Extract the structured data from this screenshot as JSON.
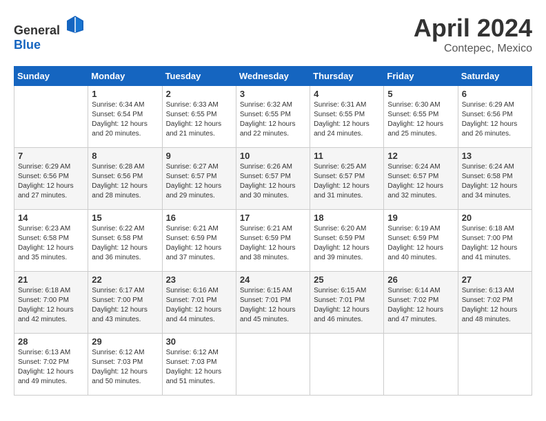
{
  "header": {
    "logo_general": "General",
    "logo_blue": "Blue",
    "month": "April 2024",
    "location": "Contepec, Mexico"
  },
  "weekdays": [
    "Sunday",
    "Monday",
    "Tuesday",
    "Wednesday",
    "Thursday",
    "Friday",
    "Saturday"
  ],
  "weeks": [
    [
      {
        "day": "",
        "info": ""
      },
      {
        "day": "1",
        "info": "Sunrise: 6:34 AM\nSunset: 6:54 PM\nDaylight: 12 hours\nand 20 minutes."
      },
      {
        "day": "2",
        "info": "Sunrise: 6:33 AM\nSunset: 6:55 PM\nDaylight: 12 hours\nand 21 minutes."
      },
      {
        "day": "3",
        "info": "Sunrise: 6:32 AM\nSunset: 6:55 PM\nDaylight: 12 hours\nand 22 minutes."
      },
      {
        "day": "4",
        "info": "Sunrise: 6:31 AM\nSunset: 6:55 PM\nDaylight: 12 hours\nand 24 minutes."
      },
      {
        "day": "5",
        "info": "Sunrise: 6:30 AM\nSunset: 6:55 PM\nDaylight: 12 hours\nand 25 minutes."
      },
      {
        "day": "6",
        "info": "Sunrise: 6:29 AM\nSunset: 6:56 PM\nDaylight: 12 hours\nand 26 minutes."
      }
    ],
    [
      {
        "day": "7",
        "info": "Sunrise: 6:29 AM\nSunset: 6:56 PM\nDaylight: 12 hours\nand 27 minutes."
      },
      {
        "day": "8",
        "info": "Sunrise: 6:28 AM\nSunset: 6:56 PM\nDaylight: 12 hours\nand 28 minutes."
      },
      {
        "day": "9",
        "info": "Sunrise: 6:27 AM\nSunset: 6:57 PM\nDaylight: 12 hours\nand 29 minutes."
      },
      {
        "day": "10",
        "info": "Sunrise: 6:26 AM\nSunset: 6:57 PM\nDaylight: 12 hours\nand 30 minutes."
      },
      {
        "day": "11",
        "info": "Sunrise: 6:25 AM\nSunset: 6:57 PM\nDaylight: 12 hours\nand 31 minutes."
      },
      {
        "day": "12",
        "info": "Sunrise: 6:24 AM\nSunset: 6:57 PM\nDaylight: 12 hours\nand 32 minutes."
      },
      {
        "day": "13",
        "info": "Sunrise: 6:24 AM\nSunset: 6:58 PM\nDaylight: 12 hours\nand 34 minutes."
      }
    ],
    [
      {
        "day": "14",
        "info": "Sunrise: 6:23 AM\nSunset: 6:58 PM\nDaylight: 12 hours\nand 35 minutes."
      },
      {
        "day": "15",
        "info": "Sunrise: 6:22 AM\nSunset: 6:58 PM\nDaylight: 12 hours\nand 36 minutes."
      },
      {
        "day": "16",
        "info": "Sunrise: 6:21 AM\nSunset: 6:59 PM\nDaylight: 12 hours\nand 37 minutes."
      },
      {
        "day": "17",
        "info": "Sunrise: 6:21 AM\nSunset: 6:59 PM\nDaylight: 12 hours\nand 38 minutes."
      },
      {
        "day": "18",
        "info": "Sunrise: 6:20 AM\nSunset: 6:59 PM\nDaylight: 12 hours\nand 39 minutes."
      },
      {
        "day": "19",
        "info": "Sunrise: 6:19 AM\nSunset: 6:59 PM\nDaylight: 12 hours\nand 40 minutes."
      },
      {
        "day": "20",
        "info": "Sunrise: 6:18 AM\nSunset: 7:00 PM\nDaylight: 12 hours\nand 41 minutes."
      }
    ],
    [
      {
        "day": "21",
        "info": "Sunrise: 6:18 AM\nSunset: 7:00 PM\nDaylight: 12 hours\nand 42 minutes."
      },
      {
        "day": "22",
        "info": "Sunrise: 6:17 AM\nSunset: 7:00 PM\nDaylight: 12 hours\nand 43 minutes."
      },
      {
        "day": "23",
        "info": "Sunrise: 6:16 AM\nSunset: 7:01 PM\nDaylight: 12 hours\nand 44 minutes."
      },
      {
        "day": "24",
        "info": "Sunrise: 6:15 AM\nSunset: 7:01 PM\nDaylight: 12 hours\nand 45 minutes."
      },
      {
        "day": "25",
        "info": "Sunrise: 6:15 AM\nSunset: 7:01 PM\nDaylight: 12 hours\nand 46 minutes."
      },
      {
        "day": "26",
        "info": "Sunrise: 6:14 AM\nSunset: 7:02 PM\nDaylight: 12 hours\nand 47 minutes."
      },
      {
        "day": "27",
        "info": "Sunrise: 6:13 AM\nSunset: 7:02 PM\nDaylight: 12 hours\nand 48 minutes."
      }
    ],
    [
      {
        "day": "28",
        "info": "Sunrise: 6:13 AM\nSunset: 7:02 PM\nDaylight: 12 hours\nand 49 minutes."
      },
      {
        "day": "29",
        "info": "Sunrise: 6:12 AM\nSunset: 7:03 PM\nDaylight: 12 hours\nand 50 minutes."
      },
      {
        "day": "30",
        "info": "Sunrise: 6:12 AM\nSunset: 7:03 PM\nDaylight: 12 hours\nand 51 minutes."
      },
      {
        "day": "",
        "info": ""
      },
      {
        "day": "",
        "info": ""
      },
      {
        "day": "",
        "info": ""
      },
      {
        "day": "",
        "info": ""
      }
    ]
  ]
}
